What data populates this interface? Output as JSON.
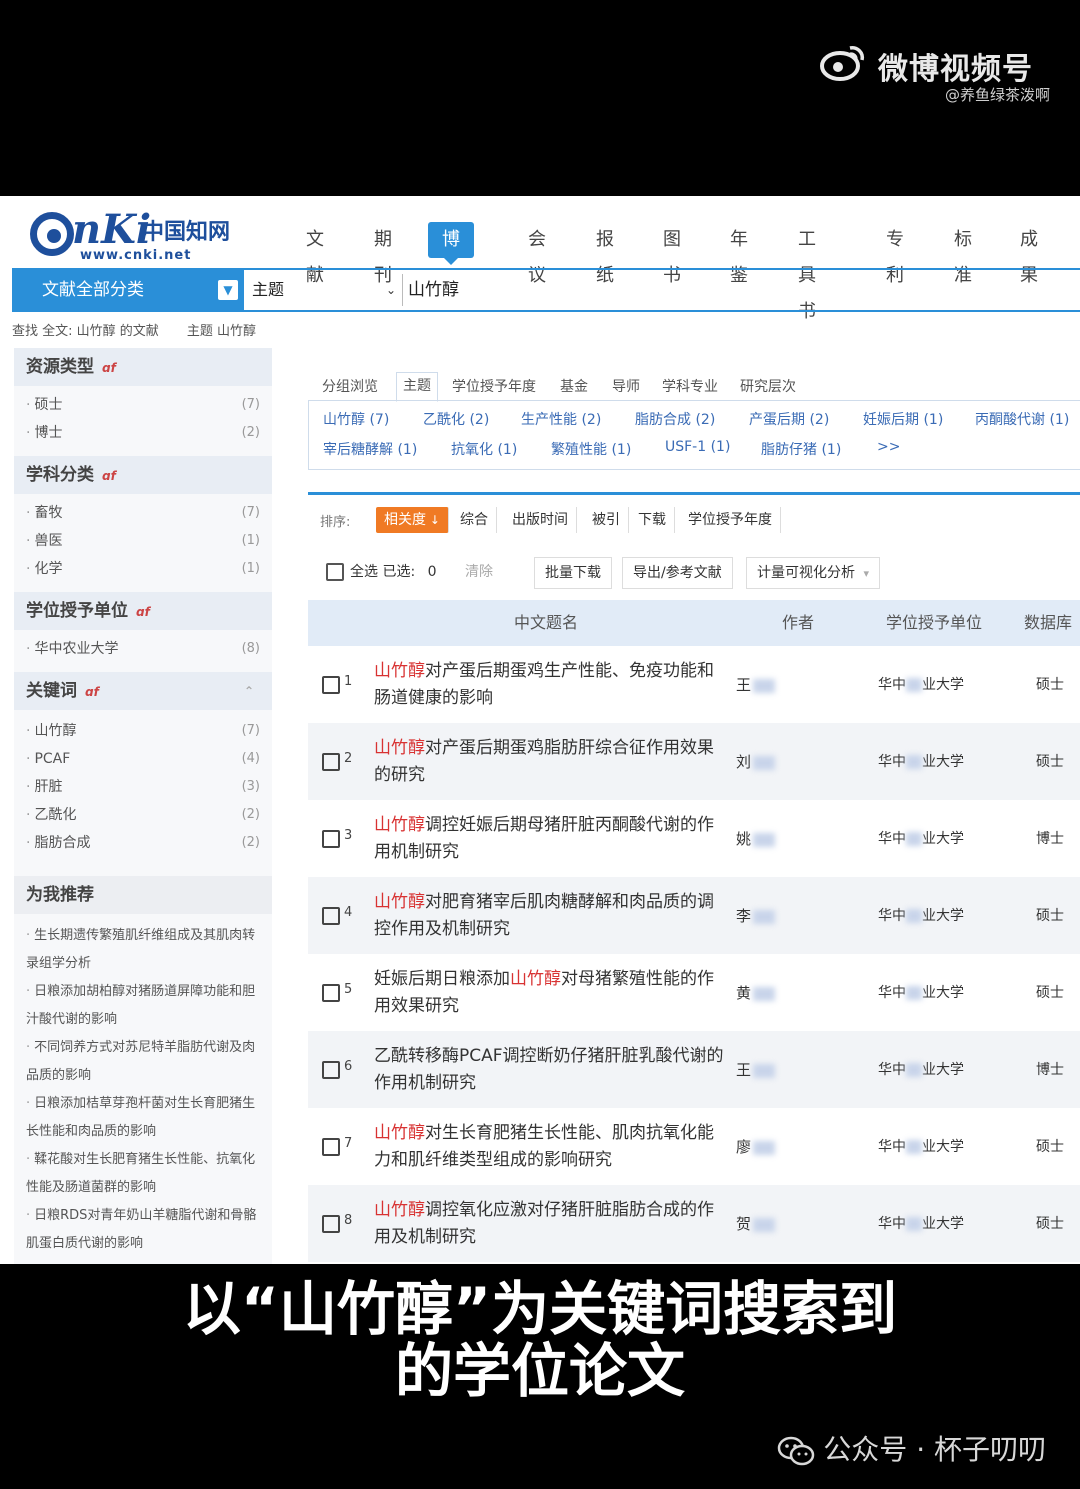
{
  "watermark_top": {
    "brand": "微博视频号",
    "handle": "@养鱼绿茶泼啊"
  },
  "cnki": {
    "logo_letters": "nKi",
    "logo_cn": "中国知网",
    "url": "www.cnki.net"
  },
  "nav_tabs": [
    "文献",
    "期刊",
    "博硕士",
    "会议",
    "报纸",
    "图书",
    "年鉴",
    "工具书",
    "专利",
    "标准",
    "成果"
  ],
  "nav_active": "博硕士",
  "search": {
    "category_button": "文献全部分类",
    "field": "主题",
    "keyword": "山竹醇"
  },
  "breadcrumb": [
    "查找 全文: 山竹醇 的文献",
    "主题 山竹醇"
  ],
  "sidebar": {
    "resource_type": {
      "title": "资源类型",
      "items": [
        {
          "label": "硕士",
          "count": "(7)"
        },
        {
          "label": "博士",
          "count": "(2)"
        }
      ]
    },
    "subject": {
      "title": "学科分类",
      "items": [
        {
          "label": "畜牧",
          "count": "(7)"
        },
        {
          "label": "兽医",
          "count": "(1)"
        },
        {
          "label": "化学",
          "count": "(1)"
        }
      ]
    },
    "degree_unit": {
      "title": "学位授予单位",
      "items": [
        {
          "label": "华中农业大学",
          "count": "(8)"
        }
      ]
    },
    "keywords": {
      "title": "关键词",
      "items": [
        {
          "label": "山竹醇",
          "count": "(7)"
        },
        {
          "label": "PCAF",
          "count": "(4)"
        },
        {
          "label": "肝脏",
          "count": "(3)"
        },
        {
          "label": "乙酰化",
          "count": "(2)"
        },
        {
          "label": "脂肪合成",
          "count": "(2)"
        }
      ]
    },
    "recommend": {
      "title": "为我推荐",
      "items": [
        "生长期遗传繁殖肌纤维组成及其肌肉转录组学分析",
        "日粮添加胡柏醇对猪肠道屏障功能和胆汁酸代谢的影响",
        "不同饲养方式对苏尼特羊脂肪代谢及肉品质的影响",
        "日粮添加桔草芽孢杆菌对生长育肥猪生长性能和肉品质的影响",
        "鞣花酸对生长肥育猪生长性能、抗氧化性能及肠道菌群的影响",
        "日粮RDS对青年奶山羊糖脂代谢和骨骼肌蛋白质代谢的影响"
      ]
    }
  },
  "group_tabs": [
    "分组浏览",
    "主题",
    "学位授予年度",
    "基金",
    "导师",
    "学科专业",
    "研究层次"
  ],
  "group_active": "主题",
  "group_items": [
    {
      "label": "山竹醇 (7)"
    },
    {
      "label": "乙酰化 (2)"
    },
    {
      "label": "生产性能 (2)"
    },
    {
      "label": "脂肪合成 (2)"
    },
    {
      "label": "产蛋后期 (2)"
    },
    {
      "label": "妊娠后期 (1)"
    },
    {
      "label": "丙酮酸代谢 (1)"
    },
    {
      "label": "宰后糖酵解 (1)"
    },
    {
      "label": "抗氧化 (1)"
    },
    {
      "label": "繁殖性能 (1)"
    },
    {
      "label": "USF-1 (1)"
    },
    {
      "label": "脂肪仔猪 (1)"
    },
    {
      "label": ">>"
    }
  ],
  "sort": {
    "label": "排序:",
    "options": [
      "相关度",
      "综合",
      "出版时间",
      "被引",
      "下载",
      "学位授予年度"
    ],
    "active": "相关度"
  },
  "toolbar": {
    "select_all": "全选",
    "selected_label": "已选:",
    "selected_count": "0",
    "clear": "清除",
    "batch_download": "批量下载",
    "export": "导出/参考文献",
    "viz": "计量可视化分析"
  },
  "table_headers": [
    "中文题名",
    "作者",
    "学位授予单位",
    "数据库"
  ],
  "rows": [
    {
      "num": "1",
      "hl": "山竹醇",
      "rest": "对产蛋后期蛋鸡生产性能、免疫功能和肠道健康的影响",
      "pre": "",
      "author": "王",
      "unit_a": "华中",
      "unit_b": "业大学",
      "db": "硕士"
    },
    {
      "num": "2",
      "hl": "山竹醇",
      "rest": "对产蛋后期蛋鸡脂肪肝综合征作用效果的研究",
      "pre": "",
      "author": "刘",
      "unit_a": "华中",
      "unit_b": "业大学",
      "db": "硕士"
    },
    {
      "num": "3",
      "hl": "山竹醇",
      "rest": "调控妊娠后期母猪肝脏丙酮酸代谢的作用机制研究",
      "pre": "",
      "author": "姚",
      "unit_a": "华中",
      "unit_b": "业大学",
      "db": "博士"
    },
    {
      "num": "4",
      "hl": "山竹醇",
      "rest": "对肥育猪宰后肌肉糖酵解和肉品质的调控作用及机制研究",
      "pre": "",
      "author": "李",
      "unit_a": "华中",
      "unit_b": "业大学",
      "db": "硕士"
    },
    {
      "num": "5",
      "hl": "山竹醇",
      "rest": "对母猪繁殖性能的作用效果研究",
      "pre": "妊娠后期日粮添加",
      "author": "黄",
      "unit_a": "华中",
      "unit_b": "业大学",
      "db": "硕士"
    },
    {
      "num": "6",
      "hl": "",
      "rest": "乙酰转移酶PCAF调控断奶仔猪肝脏乳酸代谢的作用机制研究",
      "pre": "",
      "author": "王",
      "unit_a": "华中",
      "unit_b": "业大学",
      "db": "博士"
    },
    {
      "num": "7",
      "hl": "山竹醇",
      "rest": "对生长育肥猪生长性能、肌肉抗氧化能力和肌纤维类型组成的影响研究",
      "pre": "",
      "author": "廖",
      "unit_a": "华中",
      "unit_b": "业大学",
      "db": "硕士"
    },
    {
      "num": "8",
      "hl": "山竹醇",
      "rest": "调控氧化应激对仔猪肝脏脂肪合成的作用及机制研究",
      "pre": "",
      "author": "贺",
      "unit_a": "华中",
      "unit_b": "业大学",
      "db": "硕士"
    }
  ],
  "subtitle": [
    "以“山竹醇”为关键词搜索到",
    "的学位论文"
  ],
  "watermark_bottom": "公众号 · 杯子叨叨"
}
